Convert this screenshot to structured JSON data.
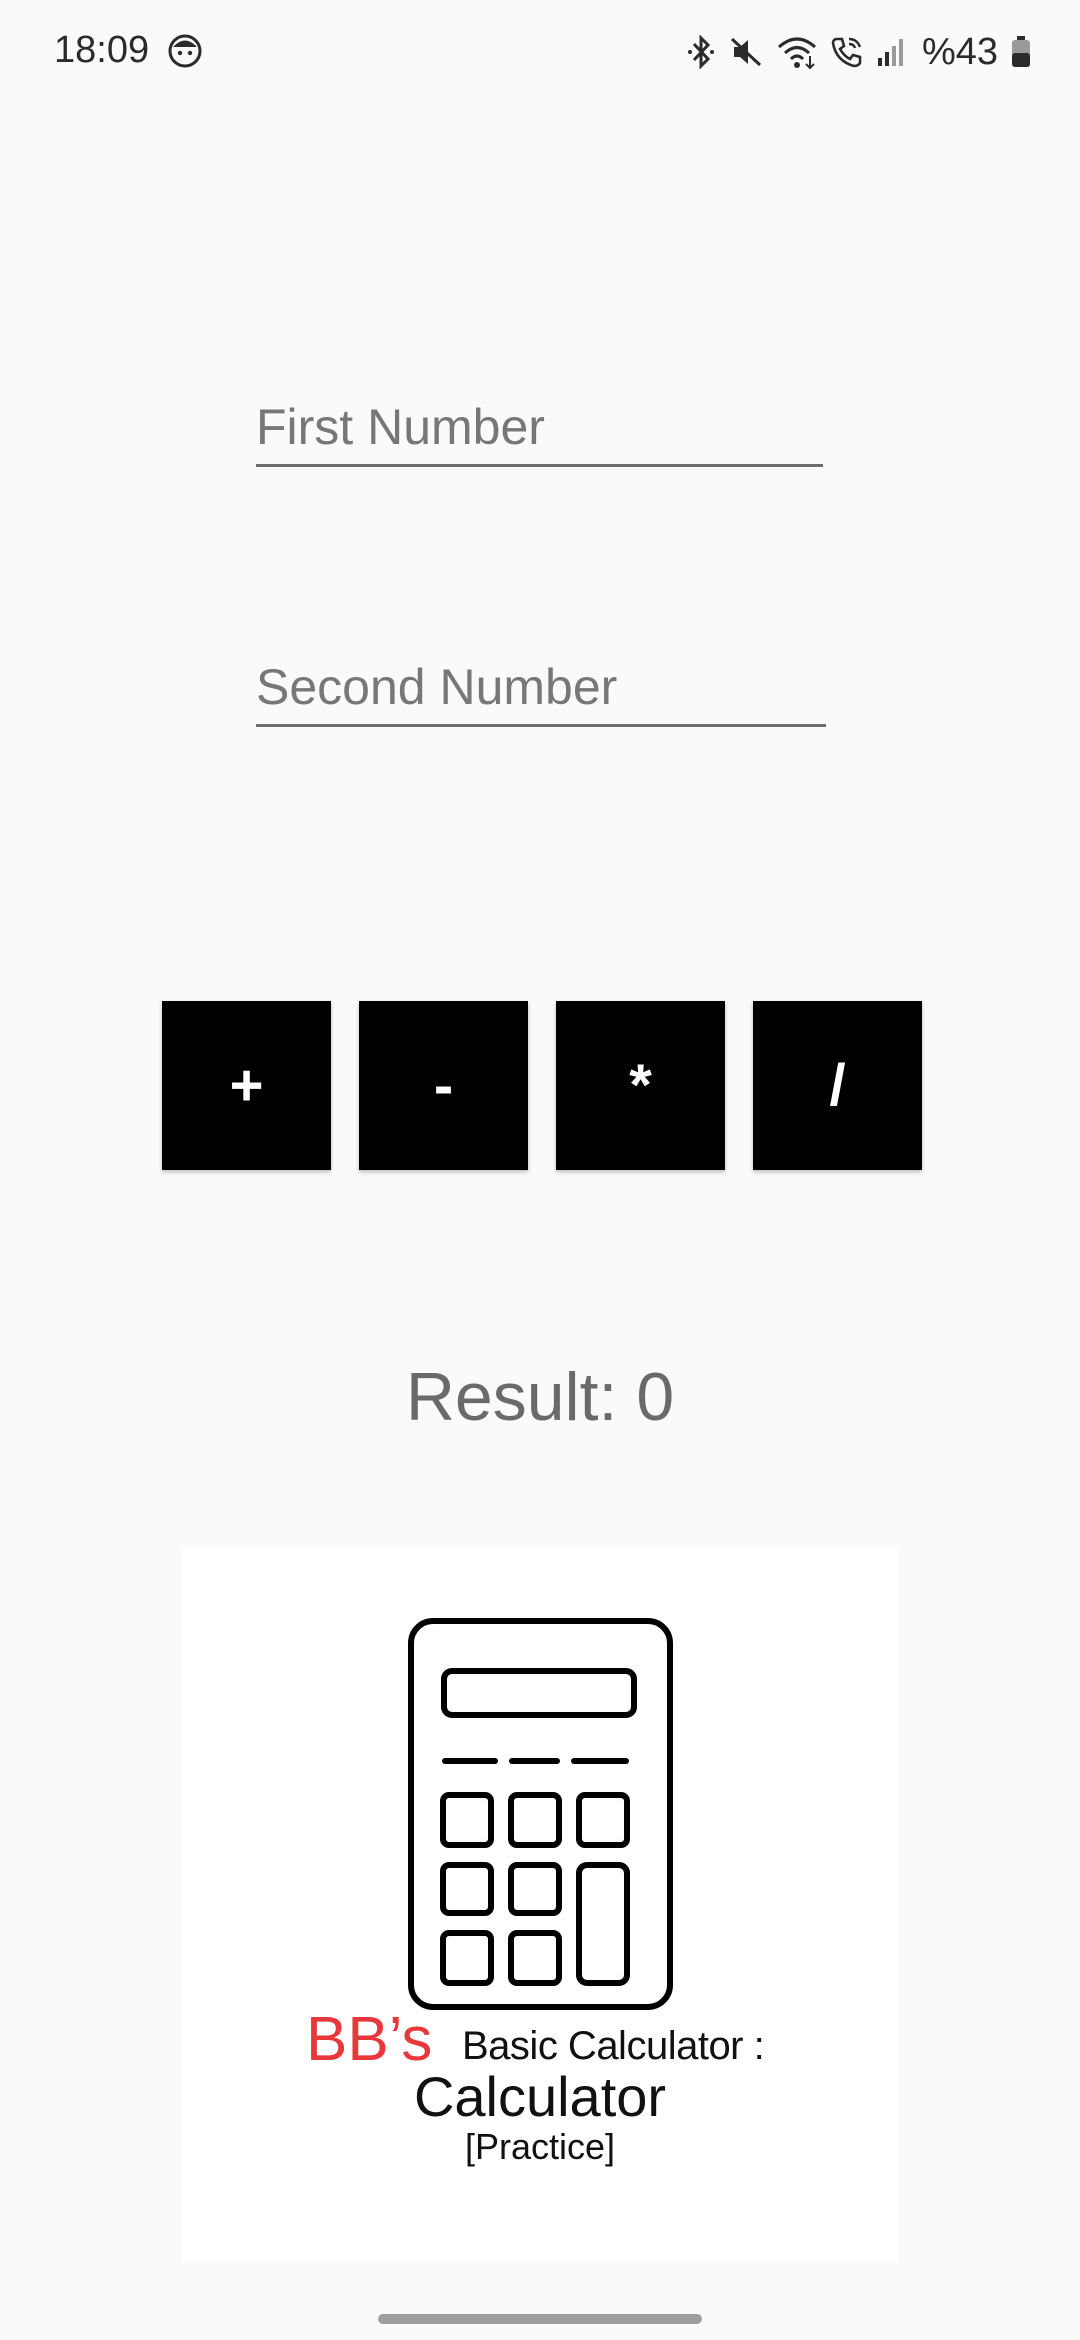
{
  "status_bar": {
    "time": "18:09",
    "battery_text": "%43",
    "icons": [
      "face-icon",
      "bluetooth-icon",
      "mute-icon",
      "wifi-icon",
      "wifi-call-icon",
      "signal-icon",
      "battery-icon"
    ]
  },
  "form": {
    "first_number": {
      "placeholder": "First Number",
      "value": ""
    },
    "second_number": {
      "placeholder": "Second Number",
      "value": ""
    }
  },
  "operators": {
    "add": "+",
    "subtract": "-",
    "multiply": "*",
    "divide": "/"
  },
  "result": {
    "label": "Result: ",
    "value": "0"
  },
  "logo": {
    "bb": "BB’s",
    "subtitle": "Basic Calculator :",
    "title": "Calculator",
    "tag": "[Practice]"
  },
  "colors": {
    "background": "#fafafa",
    "button_bg": "#000000",
    "button_text": "#ffffff",
    "result_text": "#6a6a6a",
    "brand_red": "#e8383c"
  }
}
